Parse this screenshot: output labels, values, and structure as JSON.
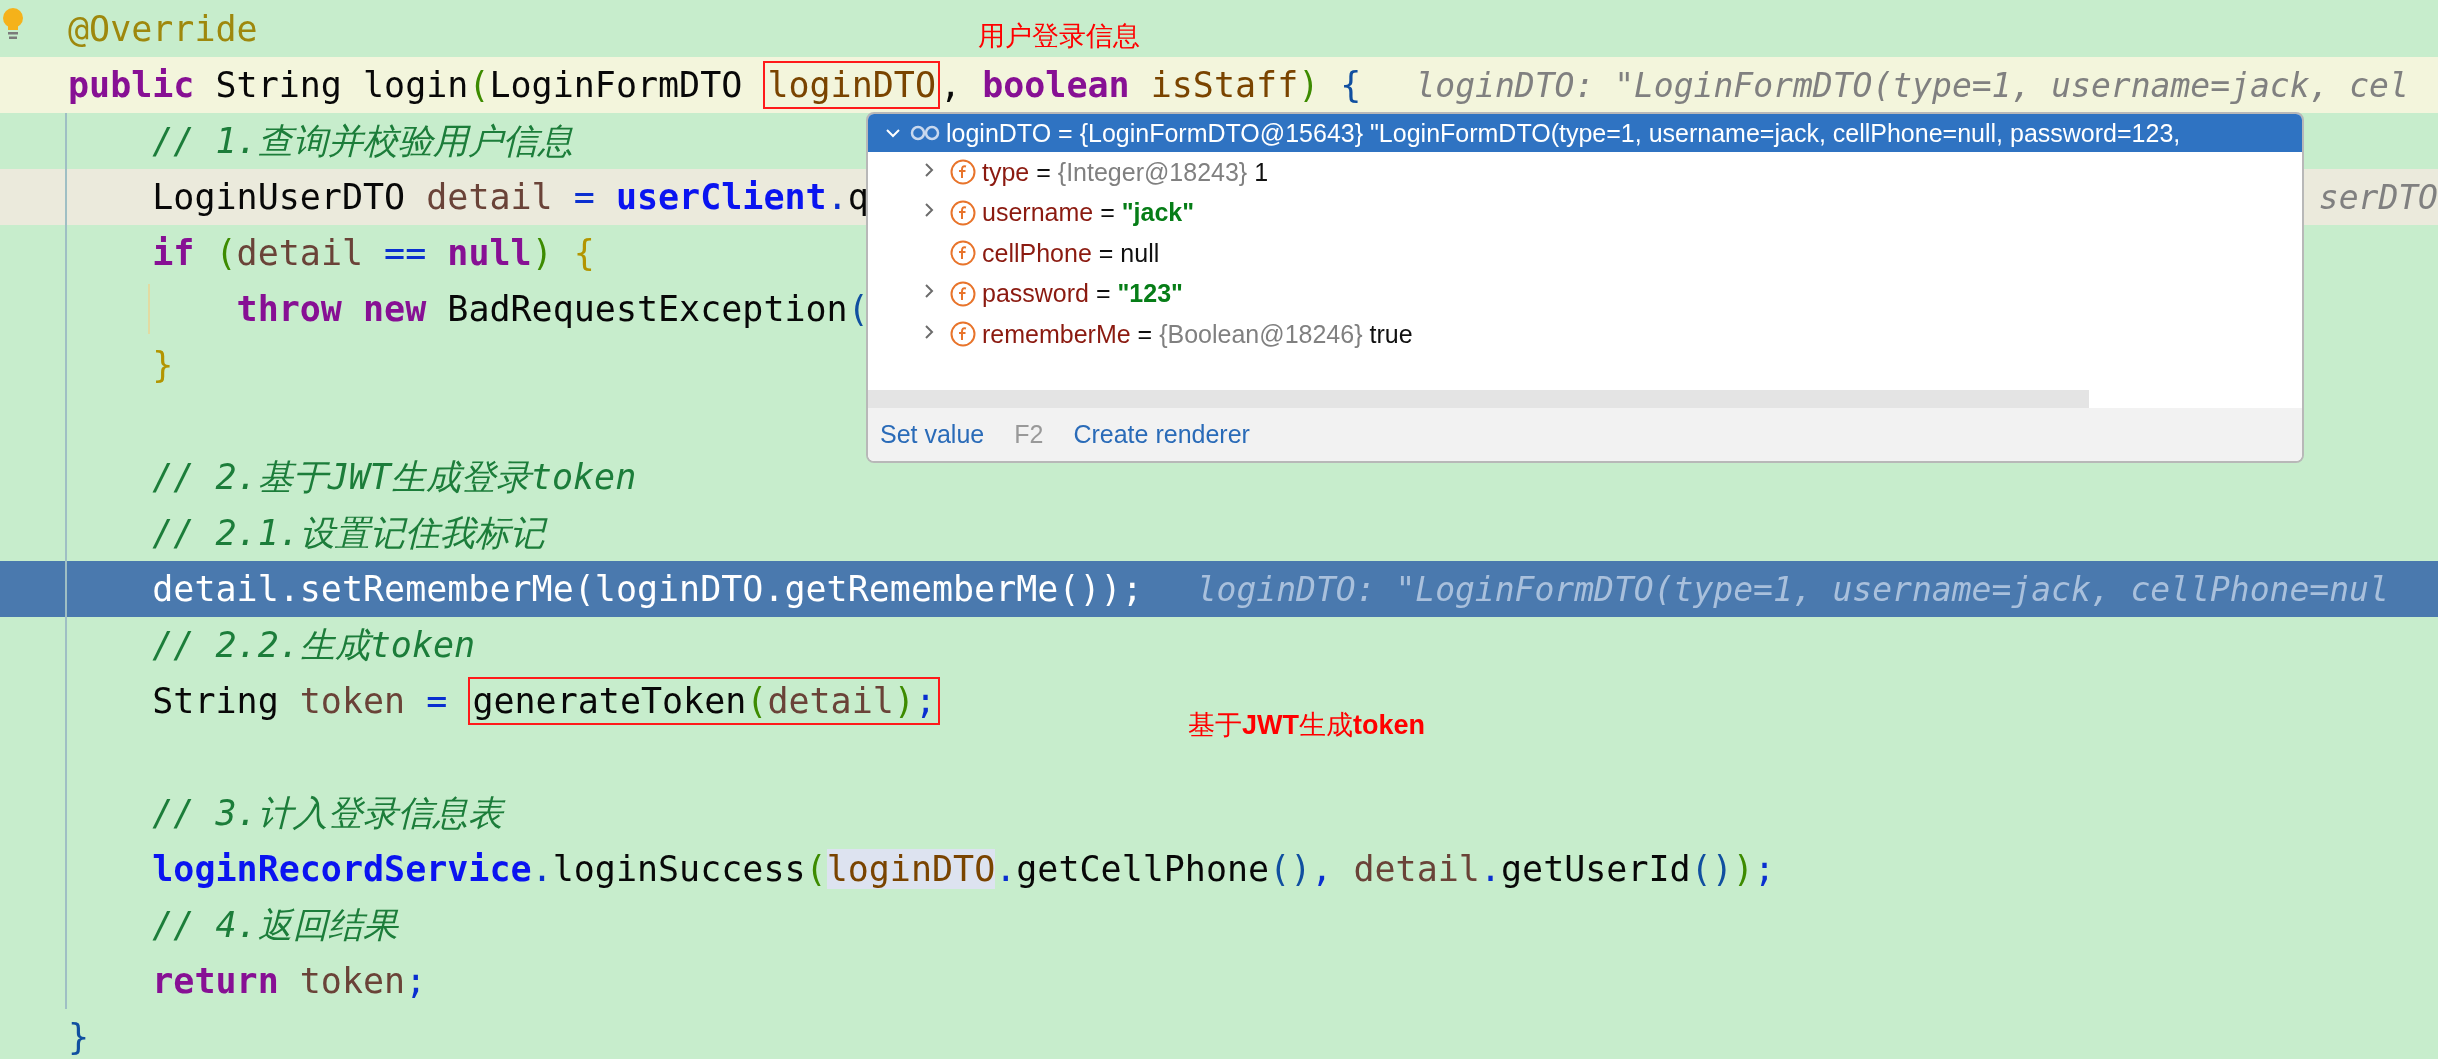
{
  "editor": {
    "lines": [
      {
        "kind": "plain",
        "tokens": [
          {
            "kind": "annotation",
            "text": "@Override"
          }
        ]
      },
      {
        "kind": "caret",
        "hint": "loginDTO: \"LoginFormDTO(type=1, username=jack, cel",
        "tokens": [
          {
            "kind": "keyword",
            "text": "public"
          },
          {
            "kind": "plain",
            "text": " String login"
          },
          {
            "kind": "bracket1",
            "text": "("
          },
          {
            "kind": "plain",
            "text": "LoginFormDTO "
          },
          {
            "kind": "box",
            "tokens": [
              {
                "kind": "param",
                "text": "loginDTO"
              }
            ]
          },
          {
            "kind": "plain",
            "text": ", "
          },
          {
            "kind": "keyword",
            "text": "boolean "
          },
          {
            "kind": "param",
            "text": "isStaff"
          },
          {
            "kind": "bracket1",
            "text": ")"
          },
          {
            "kind": "bracket2",
            "text": " {"
          }
        ]
      },
      {
        "kind": "plain",
        "tokens": [
          {
            "kind": "comment",
            "text": "    // 1.查询并校验用户信息"
          }
        ]
      },
      {
        "kind": "muted",
        "hint": "serDTO",
        "tokens": [
          {
            "kind": "plain",
            "text": "    LoginUserDTO "
          },
          {
            "kind": "var",
            "text": "detail "
          },
          {
            "kind": "op",
            "text": "= "
          },
          {
            "kind": "field",
            "text": "userClient"
          },
          {
            "kind": "op",
            "text": "."
          },
          {
            "kind": "plain",
            "text": "q"
          }
        ]
      },
      {
        "kind": "plain",
        "tokens": [
          {
            "kind": "keyword",
            "text": "    if "
          },
          {
            "kind": "bracket1",
            "text": "("
          },
          {
            "kind": "var",
            "text": "detail "
          },
          {
            "kind": "op",
            "text": "== "
          },
          {
            "kind": "keyword",
            "text": "null"
          },
          {
            "kind": "bracket1",
            "text": ")"
          },
          {
            "kind": "bracket3",
            "text": " {"
          }
        ]
      },
      {
        "kind": "plain",
        "tokens": [
          {
            "kind": "keyword",
            "text": "        throw new"
          },
          {
            "kind": "plain",
            "text": " BadRequestException"
          },
          {
            "kind": "bracket2",
            "text": "("
          }
        ]
      },
      {
        "kind": "plain",
        "tokens": [
          {
            "kind": "bracket3",
            "text": "    }"
          }
        ]
      },
      {
        "kind": "plain"
      },
      {
        "kind": "plain",
        "tokens": [
          {
            "kind": "comment",
            "text": "    // 2.基于JWT生成登录token"
          }
        ]
      },
      {
        "kind": "plain",
        "tokens": [
          {
            "kind": "comment",
            "text": "    // 2.1.设置记住我标记"
          }
        ]
      },
      {
        "kind": "execution",
        "hint": "loginDTO: \"LoginFormDTO(type=1, username=jack, cellPhone=nul",
        "tokens": [
          {
            "kind": "var",
            "text": "    detail"
          },
          {
            "kind": "op",
            "text": "."
          },
          {
            "kind": "plain",
            "text": "setRememberMe"
          },
          {
            "kind": "bracket1",
            "text": "("
          },
          {
            "kind": "param",
            "text": "loginDTO"
          },
          {
            "kind": "op",
            "text": "."
          },
          {
            "kind": "plain",
            "text": "getRememberMe"
          },
          {
            "kind": "bracket2",
            "text": "()"
          },
          {
            "kind": "bracket1",
            "text": ")"
          },
          {
            "kind": "op",
            "text": ";"
          }
        ]
      },
      {
        "kind": "plain",
        "tokens": [
          {
            "kind": "comment",
            "text": "    // 2.2.生成token"
          }
        ]
      },
      {
        "kind": "plain",
        "tokens": [
          {
            "kind": "plain",
            "text": "    String "
          },
          {
            "kind": "var",
            "text": "token "
          },
          {
            "kind": "op",
            "text": "= "
          },
          {
            "kind": "box",
            "tokens": [
              {
                "kind": "plain",
                "text": "generateToken"
              },
              {
                "kind": "bracket1",
                "text": "("
              },
              {
                "kind": "var",
                "text": "detail"
              },
              {
                "kind": "bracket1",
                "text": ")"
              },
              {
                "kind": "op",
                "text": ";"
              }
            ]
          }
        ]
      },
      {
        "kind": "plain"
      },
      {
        "kind": "plain",
        "tokens": [
          {
            "kind": "comment",
            "text": "    // 3.计入登录信息表"
          }
        ]
      },
      {
        "kind": "plain",
        "tokens": [
          {
            "kind": "field",
            "text": "    loginRecordService"
          },
          {
            "kind": "op",
            "text": "."
          },
          {
            "kind": "plain",
            "text": "loginSuccess"
          },
          {
            "kind": "bracket1",
            "text": "("
          },
          {
            "kind": "usage",
            "text": "loginDTO"
          },
          {
            "kind": "op",
            "text": "."
          },
          {
            "kind": "plain",
            "text": "getCellPhone"
          },
          {
            "kind": "bracket2",
            "text": "()"
          },
          {
            "kind": "op",
            "text": ", "
          },
          {
            "kind": "var",
            "text": "detail"
          },
          {
            "kind": "op",
            "text": "."
          },
          {
            "kind": "plain",
            "text": "getUserId"
          },
          {
            "kind": "bracket2",
            "text": "()"
          },
          {
            "kind": "bracket1",
            "text": ")"
          },
          {
            "kind": "op",
            "text": ";"
          }
        ]
      },
      {
        "kind": "plain",
        "tokens": [
          {
            "kind": "comment",
            "text": "    // 4.返回结果"
          }
        ]
      },
      {
        "kind": "plain",
        "tokens": [
          {
            "kind": "keyword",
            "text": "    return "
          },
          {
            "kind": "var",
            "text": "token"
          },
          {
            "kind": "op",
            "text": ";"
          }
        ]
      },
      {
        "kind": "plain",
        "tokens": [
          {
            "kind": "bracket2",
            "text": "}"
          }
        ]
      }
    ]
  },
  "debug_popup": {
    "header": {
      "expanded": true,
      "selected": true,
      "text": "loginDTO = {LoginFormDTO@15643} \"LoginFormDTO(type=1, username=jack, cellPhone=null, password=123,"
    },
    "fields": [
      {
        "kind": "plain",
        "name": "type",
        "operator": "=",
        "type_ref": "{Integer@18243}",
        "value": "1",
        "expandable": true
      },
      {
        "kind": "string",
        "name": "username",
        "operator": "=",
        "value": "\"jack\"",
        "expandable": true
      },
      {
        "kind": "plain",
        "name": "cellPhone",
        "operator": "=",
        "value": "null",
        "expandable": false
      },
      {
        "kind": "string",
        "name": "password",
        "operator": "=",
        "value": "\"123\"",
        "expandable": true
      },
      {
        "kind": "plain",
        "name": "rememberMe",
        "operator": "=",
        "type_ref": "{Boolean@18246}",
        "value": "true",
        "expandable": true
      }
    ],
    "actions": [
      {
        "label": "Set value",
        "shortcut": "F2"
      },
      {
        "label": "Create renderer"
      }
    ]
  },
  "annotations": [
    {
      "text": "用户登录信息"
    },
    {
      "text": "基于**JWT**生成**token**"
    }
  ]
}
